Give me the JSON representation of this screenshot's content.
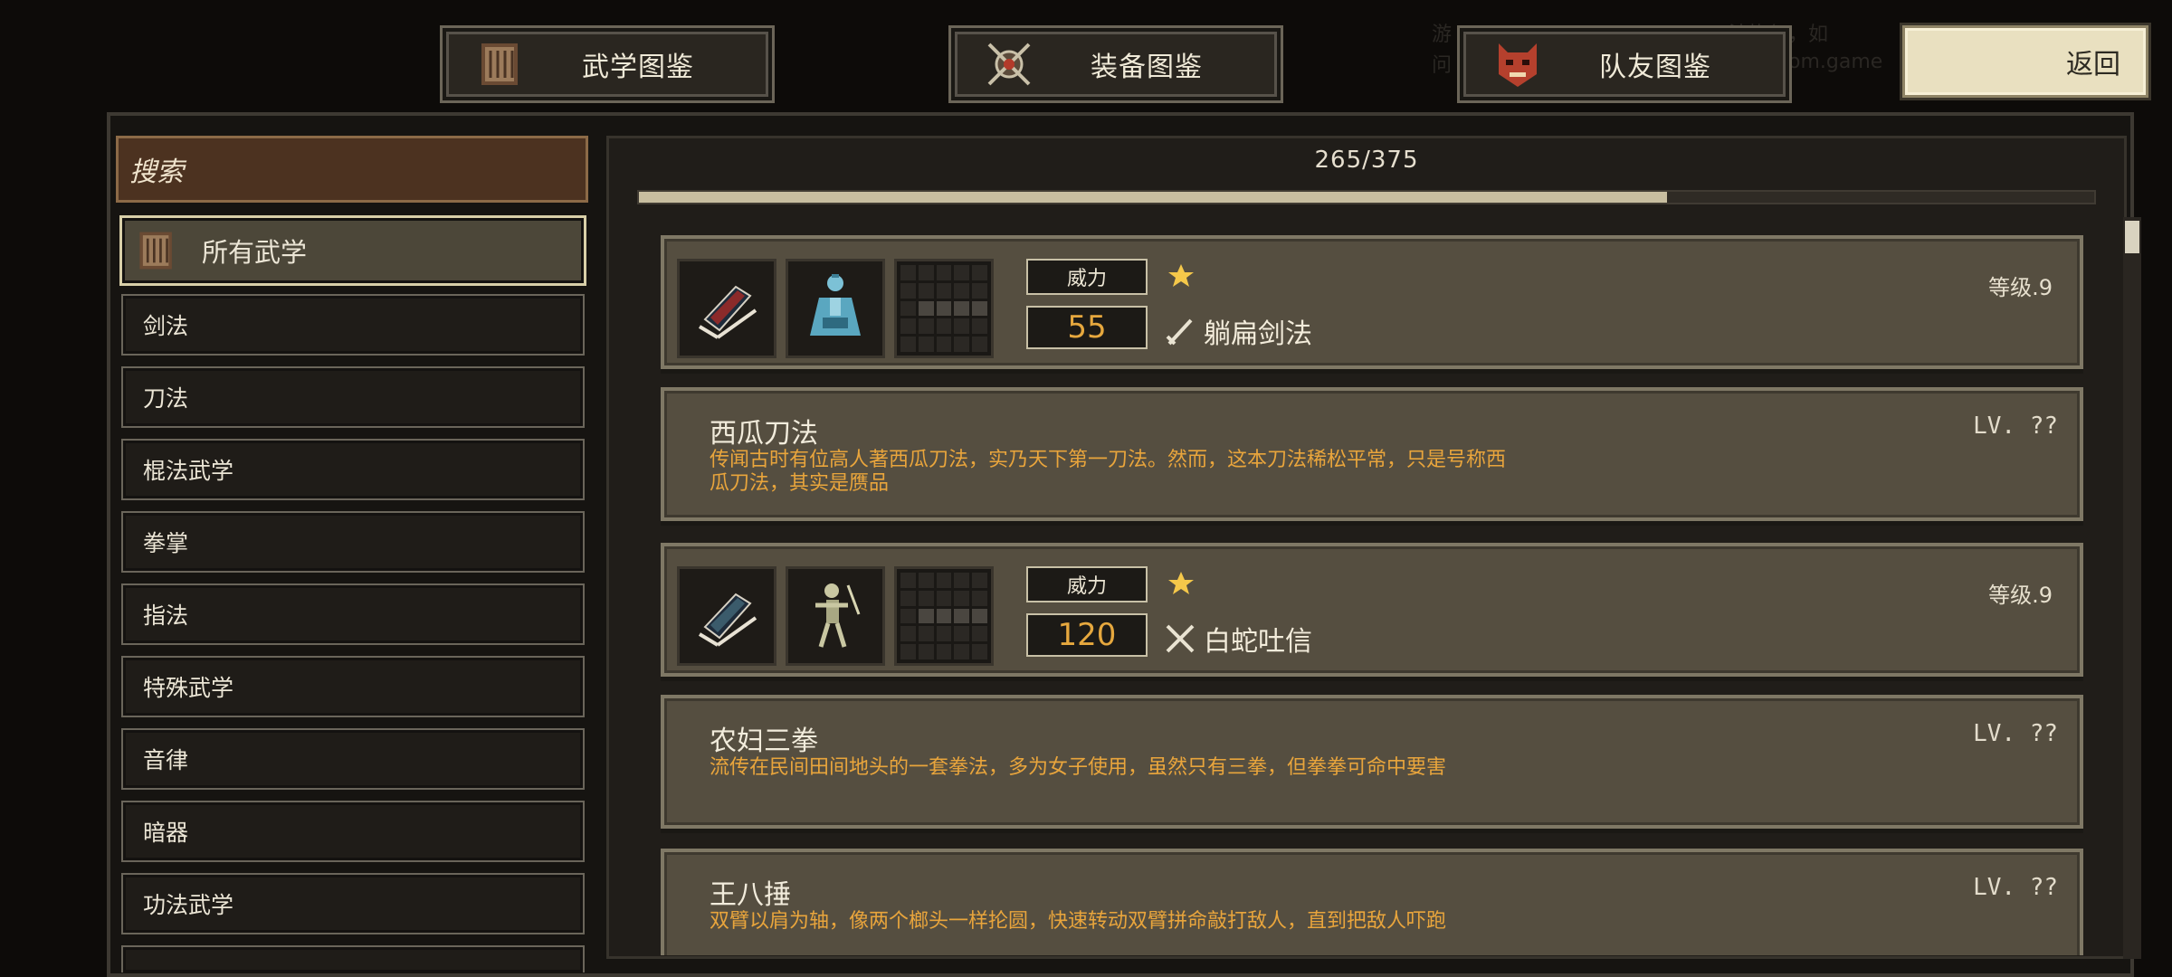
{
  "tabs": [
    {
      "label": "武学图鉴",
      "icon": "scroll-book-icon"
    },
    {
      "label": "装备图鉴",
      "icon": "crossed-weapons-icon"
    },
    {
      "label": "队友图鉴",
      "icon": "demon-mask-icon"
    }
  ],
  "back_label": "返回",
  "watermark": {
    "line1": "游",
    "line1b": "法恢复，如",
    "line2": "问",
    "line2b": "om.game"
  },
  "search_label": "搜索",
  "categories": [
    "所有武学",
    "剑法",
    "刀法",
    "棍法武学",
    "拳掌",
    "指法",
    "特殊武学",
    "音律",
    "暗器",
    "功法武学"
  ],
  "progress": {
    "text": "265/375",
    "current": 265,
    "total": 375
  },
  "entries": [
    {
      "type": "detail",
      "power_label": "威力",
      "power": "55",
      "stars": 1,
      "name": "躺扁剑法",
      "weapon_icon": "sword-icon",
      "level": "等级.9",
      "book_color": "#8b2a2a",
      "char_icon": "blue-robed-figure-icon"
    },
    {
      "type": "locked",
      "title": "西瓜刀法",
      "lv": "LV. ??",
      "desc": "传闻古时有位高人著西瓜刀法，实乃天下第一刀法。然而，这本刀法稀松平常，只是号称西瓜刀法，其实是赝品"
    },
    {
      "type": "detail",
      "power_label": "威力",
      "power": "120",
      "stars": 1,
      "name": "白蛇吐信",
      "weapon_icon": "crossed-fists-icon",
      "level": "等级.9",
      "book_color": "#3b5b6b",
      "char_icon": "skeleton-warrior-icon"
    },
    {
      "type": "locked",
      "title": "农妇三拳",
      "lv": "LV. ??",
      "desc": "流传在民间田间地头的一套拳法，多为女子使用，虽然只有三拳，但拳拳可命中要害"
    },
    {
      "type": "locked",
      "title": "王八捶",
      "lv": "LV. ??",
      "desc": "双臂以肩为轴，像两个榔头一样抡圆，快速转动双臂拼命敲打敌人，直到把敌人吓跑"
    }
  ],
  "colors": {
    "accent_orange": "#e9a53c",
    "power_value": "#e6a83e",
    "search_bg": "#4c3220"
  }
}
